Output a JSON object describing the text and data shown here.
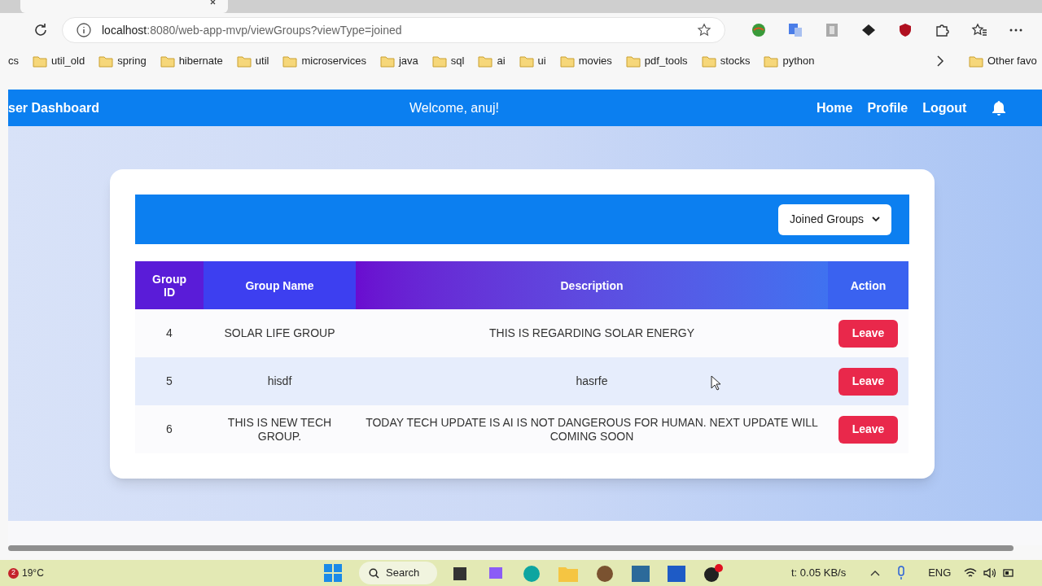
{
  "browser": {
    "address_host": "localhost",
    "address_path": ":8080/web-app-mvp/viewGroups?viewType=joined",
    "bookmarks": [
      "cs",
      "util_old",
      "spring",
      "hibernate",
      "util",
      "microservices",
      "java",
      "sql",
      "ai",
      "ui",
      "movies",
      "pdf_tools",
      "stocks",
      "python"
    ],
    "other_bookmarks": "Other favo"
  },
  "navbar": {
    "brand": "ser Dashboard",
    "welcome": "Welcome, anuj!",
    "links": [
      "Home",
      "Profile",
      "Logout"
    ]
  },
  "card": {
    "filter": {
      "value": "Joined Groups"
    },
    "table": {
      "columns": [
        "Group ID",
        "Group Name",
        "Description",
        "Action"
      ],
      "rows": [
        {
          "id": "4",
          "name": "SOLAR LIFE GROUP",
          "description": "THIS IS REGARDING SOLAR ENERGY",
          "action": "Leave"
        },
        {
          "id": "5",
          "name": "hisdf",
          "description": "hasrfe",
          "action": "Leave"
        },
        {
          "id": "6",
          "name": "THIS IS NEW TECH GROUP.",
          "description": "TODAY TECH UPDATE IS AI IS NOT DANGEROUS FOR HUMAN. NEXT UPDATE WILL COMING SOON",
          "action": "Leave"
        }
      ]
    }
  },
  "taskbar": {
    "weather_badge": "2",
    "temperature": "19°C",
    "search": "Search",
    "network": "t: 0.05 KB/s",
    "language": "ENG"
  }
}
